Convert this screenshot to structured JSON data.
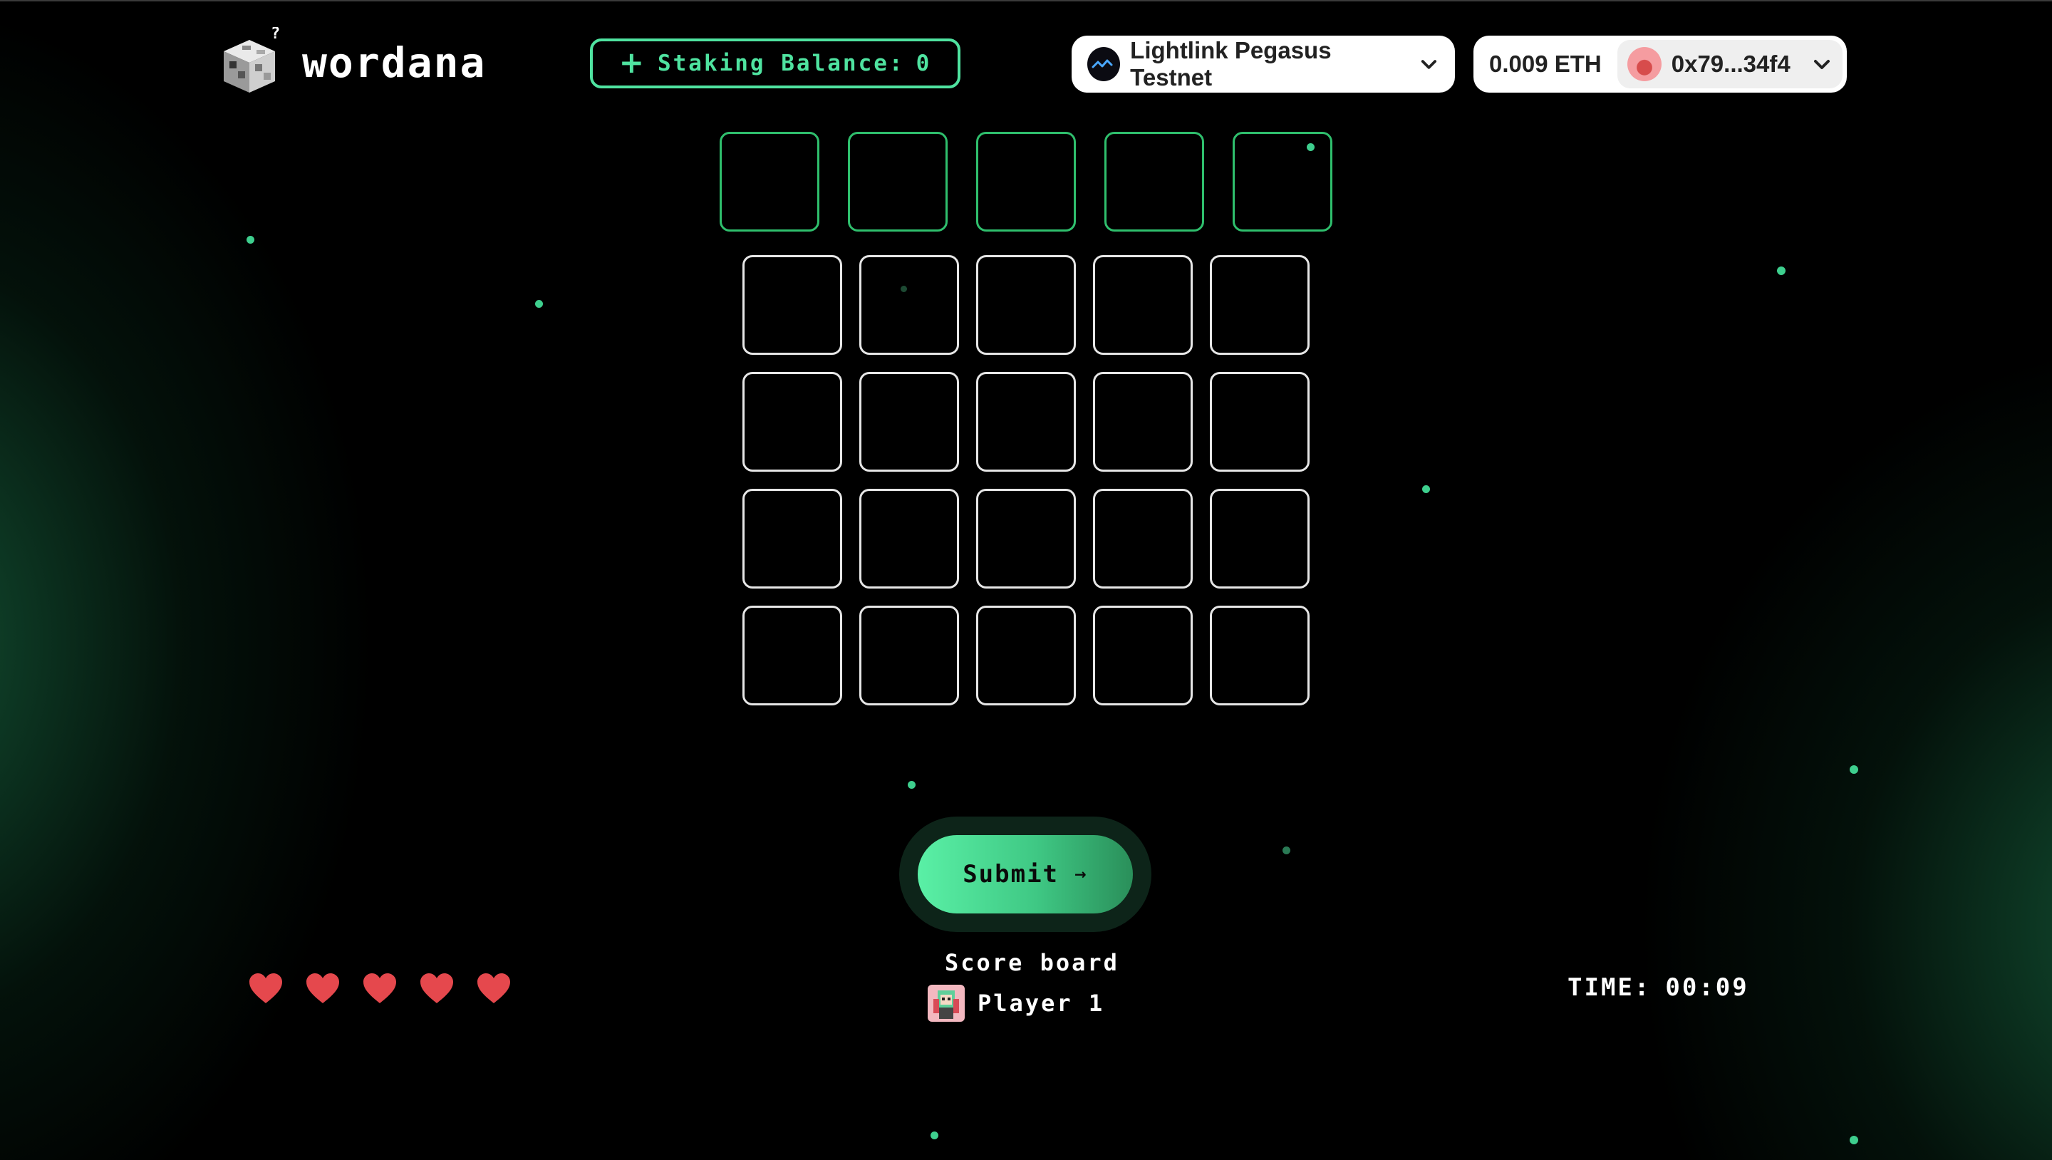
{
  "app": {
    "name": "wordana"
  },
  "header": {
    "staking": {
      "plus_icon": "plus-icon",
      "label": "Staking Balance:",
      "value": "0"
    },
    "network": {
      "icon": "lightlink-icon",
      "name": "Lightlink Pegasus Testnet"
    },
    "wallet": {
      "balance": "0.009 ETH",
      "avatar_icon": "wallet-avatar-icon",
      "address": "0x79...34f4"
    }
  },
  "board": {
    "top_row_count": 5,
    "rows": 4,
    "cols": 5
  },
  "submit": {
    "label": "Submit",
    "arrow": "→"
  },
  "lives": {
    "count": 5,
    "icon": "heart-icon"
  },
  "scoreboard": {
    "title": "Score board",
    "players": [
      {
        "name": "Player 1",
        "avatar": "player-avatar-icon"
      }
    ]
  },
  "timer": {
    "label": "TIME:",
    "value": "00:09"
  },
  "colors": {
    "accent": "#4fe3a0",
    "tile_border_top": "#2fbf6d",
    "tile_border": "#e6e6e6",
    "heart": "#e5484d"
  }
}
